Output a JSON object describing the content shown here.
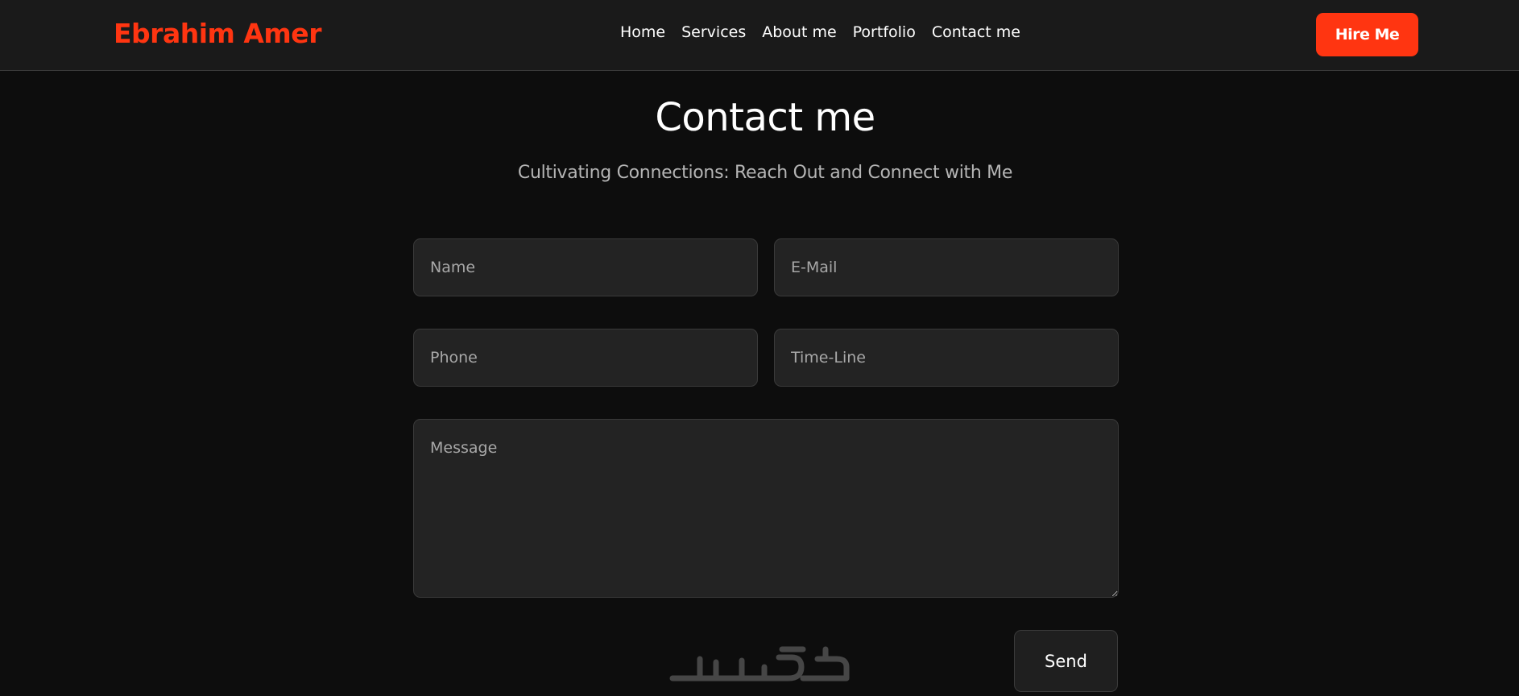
{
  "header": {
    "brand": "Ebrahim Amer",
    "nav": [
      "Home",
      "Services",
      "About me",
      "Portfolio",
      "Contact me"
    ],
    "hire_label": "Hire Me"
  },
  "contact": {
    "title": "Contact me",
    "subtitle": "Cultivating Connections: Reach Out and Connect with Me",
    "fields": {
      "name": {
        "placeholder": "Name",
        "value": ""
      },
      "email": {
        "placeholder": "E-Mail",
        "value": ""
      },
      "phone": {
        "placeholder": "Phone",
        "value": ""
      },
      "timeline": {
        "placeholder": "Time-Line",
        "value": ""
      },
      "message": {
        "placeholder": "Message",
        "value": ""
      }
    },
    "send_label": "Send"
  },
  "colors": {
    "accent": "#ff3511",
    "background": "#0d0d0d",
    "navbar": "#1a1a1a",
    "field_bg": "#232323"
  },
  "watermark": {
    "icon": "khamsat-logo"
  }
}
